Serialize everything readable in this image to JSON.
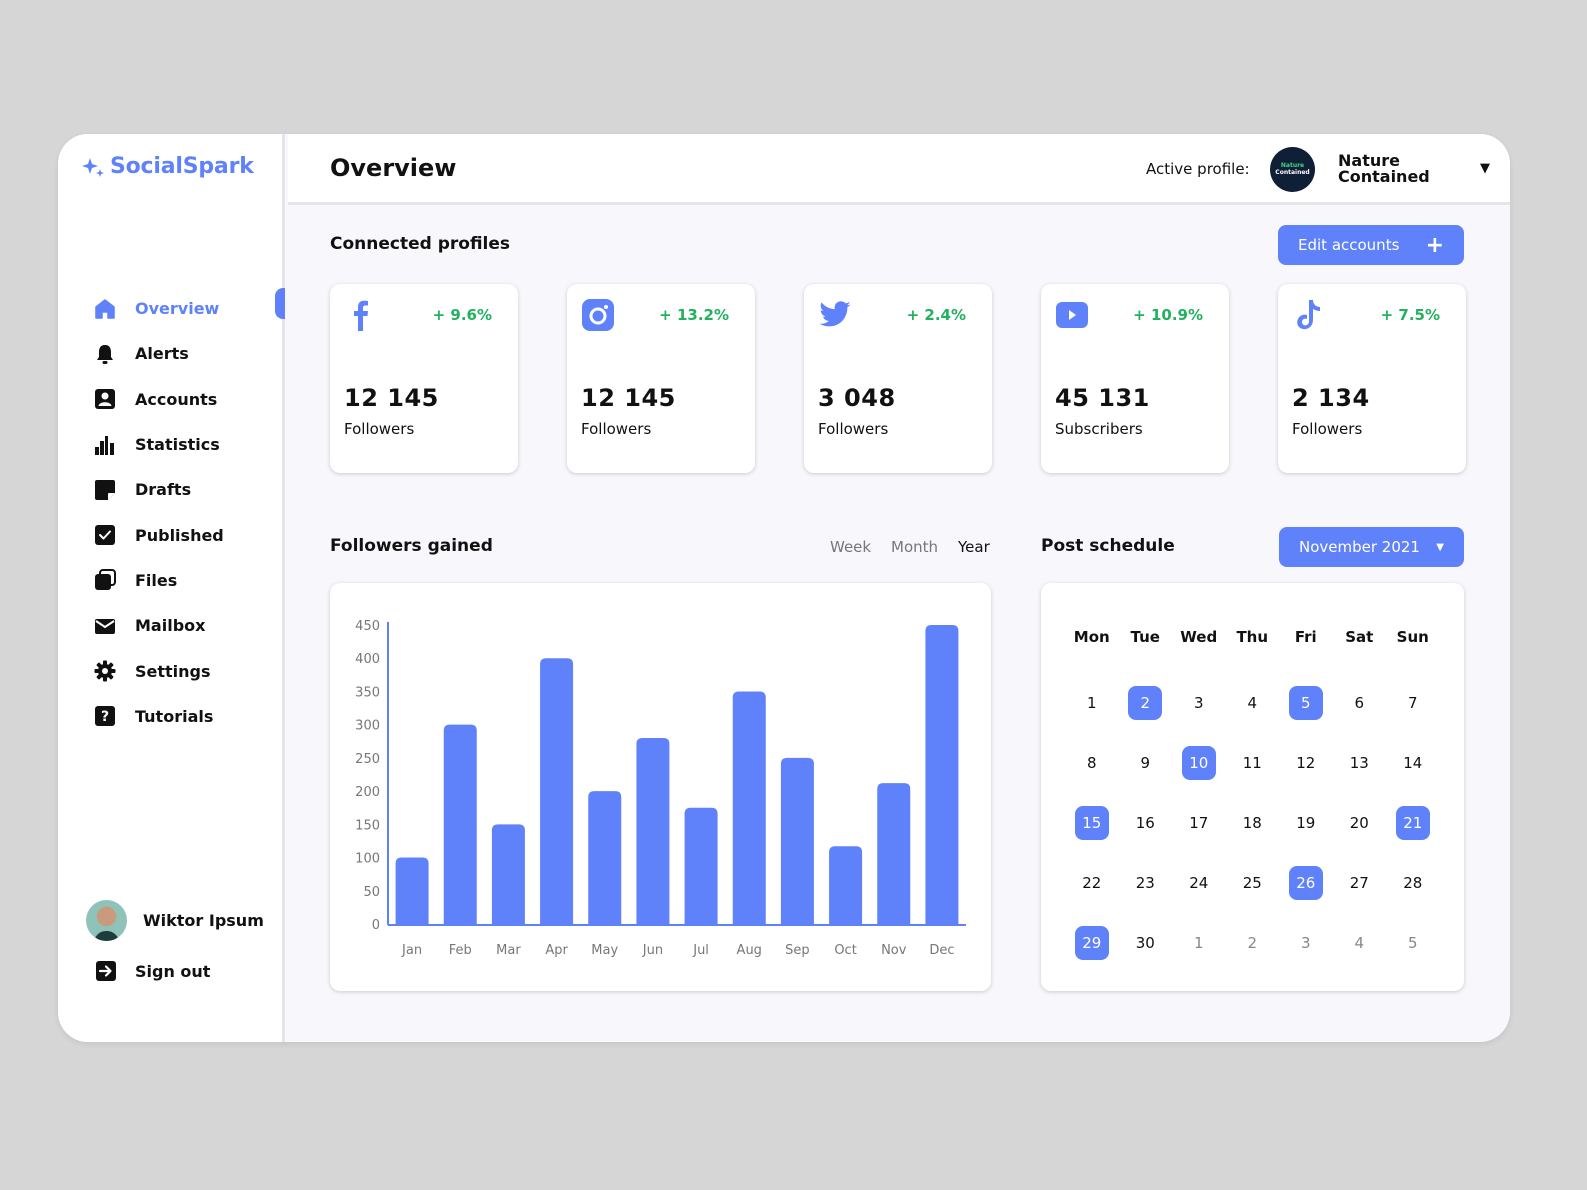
{
  "app": {
    "name": "SocialSpark",
    "accent": "#5f82fb",
    "positive": "#22b15e"
  },
  "header": {
    "title": "Overview",
    "active_profile_label": "Active profile:",
    "profile_logo_line1": "Nature",
    "profile_logo_line2": "Contained",
    "profile_name": "Nature Contained",
    "profile_caret": "▼"
  },
  "sidebar": {
    "items": [
      {
        "label": "Overview",
        "icon": "home-icon",
        "active": true
      },
      {
        "label": "Alerts",
        "icon": "bell-icon"
      },
      {
        "label": "Accounts",
        "icon": "account-icon"
      },
      {
        "label": "Statistics",
        "icon": "bar-chart-icon"
      },
      {
        "label": "Drafts",
        "icon": "note-icon"
      },
      {
        "label": "Published",
        "icon": "check-box-icon"
      },
      {
        "label": "Files",
        "icon": "files-icon"
      },
      {
        "label": "Mailbox",
        "icon": "mail-icon"
      },
      {
        "label": "Settings",
        "icon": "gear-icon"
      },
      {
        "label": "Tutorials",
        "icon": "help-icon"
      }
    ],
    "user_name": "Wiktor Ipsum",
    "signout_label": "Sign out"
  },
  "profiles": {
    "title": "Connected profiles",
    "edit_label": "Edit accounts",
    "edit_icon": "+",
    "cards": [
      {
        "platform": "facebook",
        "change": "+ 9.6%",
        "count": "12 145",
        "unit": "Followers"
      },
      {
        "platform": "instagram",
        "change": "+ 13.2%",
        "count": "12 145",
        "unit": "Followers"
      },
      {
        "platform": "twitter",
        "change": "+ 2.4%",
        "count": "3 048",
        "unit": "Followers"
      },
      {
        "platform": "youtube",
        "change": "+ 10.9%",
        "count": "45 131",
        "unit": "Subscribers"
      },
      {
        "platform": "tiktok",
        "change": "+ 7.5%",
        "count": "2 134",
        "unit": "Followers"
      }
    ]
  },
  "followers": {
    "title": "Followers gained",
    "ranges": [
      "Week",
      "Month",
      "Year"
    ],
    "selected_range": "Year"
  },
  "chart_data": {
    "type": "bar",
    "title": "Followers gained",
    "categories": [
      "Jan",
      "Feb",
      "Mar",
      "Apr",
      "May",
      "Jun",
      "Jul",
      "Aug",
      "Sep",
      "Oct",
      "Nov",
      "Dec"
    ],
    "values": [
      100,
      300,
      150,
      400,
      200,
      280,
      175,
      350,
      250,
      117,
      212,
      450
    ],
    "xlabel": "",
    "ylabel": "",
    "ylim": [
      0,
      450
    ],
    "yticks": [
      0,
      50,
      100,
      150,
      200,
      250,
      300,
      350,
      400,
      450
    ],
    "grid": false,
    "color": "#5f82fb"
  },
  "schedule": {
    "title": "Post schedule",
    "month_label": "November 2021",
    "caret": "▼",
    "weekdays": [
      "Mon",
      "Tue",
      "Wed",
      "Thu",
      "Fri",
      "Sat",
      "Sun"
    ],
    "days": [
      {
        "d": "1"
      },
      {
        "d": "2",
        "mark": true
      },
      {
        "d": "3"
      },
      {
        "d": "4"
      },
      {
        "d": "5",
        "mark": true
      },
      {
        "d": "6"
      },
      {
        "d": "7"
      },
      {
        "d": "8"
      },
      {
        "d": "9"
      },
      {
        "d": "10",
        "mark": true
      },
      {
        "d": "11"
      },
      {
        "d": "12"
      },
      {
        "d": "13"
      },
      {
        "d": "14"
      },
      {
        "d": "15",
        "mark": true
      },
      {
        "d": "16"
      },
      {
        "d": "17"
      },
      {
        "d": "18"
      },
      {
        "d": "19"
      },
      {
        "d": "20"
      },
      {
        "d": "21",
        "mark": true
      },
      {
        "d": "22"
      },
      {
        "d": "23"
      },
      {
        "d": "24"
      },
      {
        "d": "25"
      },
      {
        "d": "26",
        "mark": true
      },
      {
        "d": "27"
      },
      {
        "d": "28"
      },
      {
        "d": "29",
        "mark": true
      },
      {
        "d": "30"
      },
      {
        "d": "1",
        "other": true
      },
      {
        "d": "2",
        "other": true
      },
      {
        "d": "3",
        "other": true
      },
      {
        "d": "4",
        "other": true
      },
      {
        "d": "5",
        "other": true
      }
    ]
  }
}
